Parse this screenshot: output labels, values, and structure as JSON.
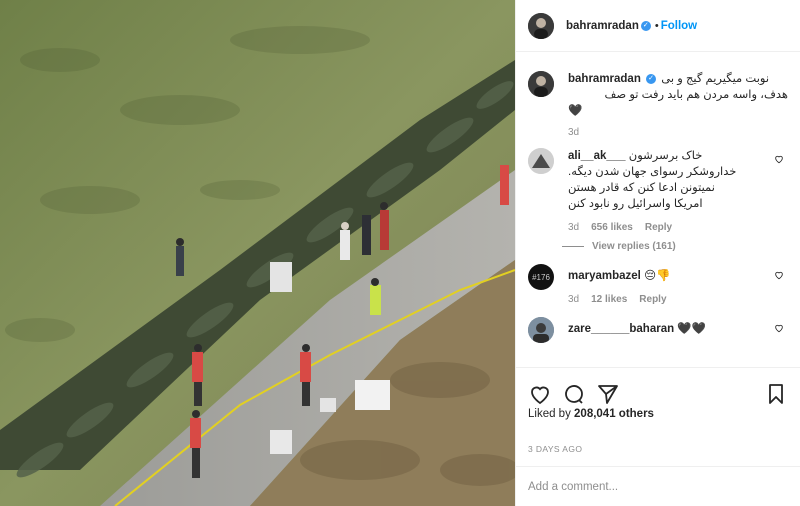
{
  "header": {
    "username": "bahramradan",
    "verified_mark": "✓",
    "dot": "•",
    "follow_label": "Follow"
  },
  "caption": {
    "username": "bahramradan",
    "verified_mark": "✓",
    "text_line1": "نوبت میگیریم گیج و بی",
    "text_line2": "هدف، واسه مردن هم باید رفت تو صف",
    "emoji": "🖤",
    "time": "3d"
  },
  "comments": [
    {
      "username": "ali__ak___",
      "lines": [
        "خاک برسرشون",
        "خداروشکر رسوای جهان شدن دیگه.",
        "نمیتونن ادعا کنن که قادر هستن",
        "امریکا واسرائیل رو نابود کنن"
      ],
      "time": "3d",
      "likes": "656 likes",
      "reply_label": "Reply",
      "view_replies": "View replies (161)"
    },
    {
      "username": "maryambazel",
      "text": "😔👎",
      "time": "3d",
      "likes": "12 likes",
      "reply_label": "Reply",
      "avatar_text": "#176"
    },
    {
      "username": "zare______baharan",
      "text": "🖤🖤"
    }
  ],
  "likes": {
    "prefix": "Liked by ",
    "count": "208,041 others"
  },
  "timestamp": "3 DAYS AGO",
  "add_comment": {
    "placeholder": "Add a comment..."
  },
  "icons": [
    "heart-icon",
    "comment-icon",
    "share-icon",
    "bookmark-icon",
    "verified-icon"
  ],
  "colors": {
    "accent": "#0095f6",
    "text": "#262626",
    "muted": "#8e8e8e"
  }
}
